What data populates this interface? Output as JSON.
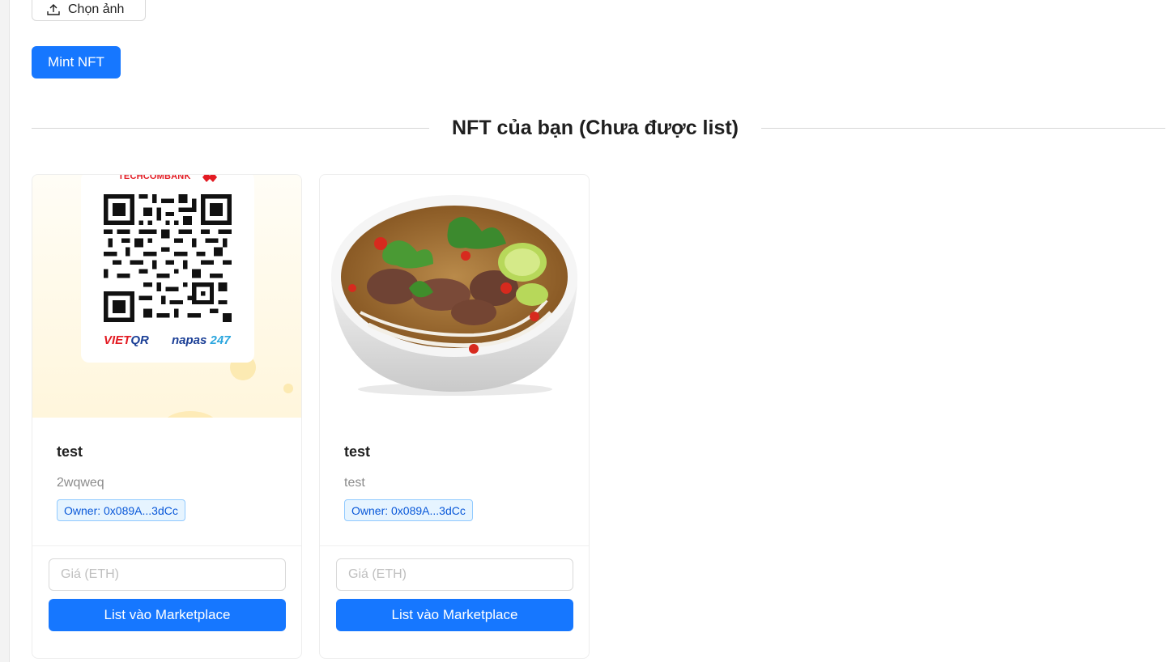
{
  "upload": {
    "label": "Chọn ảnh",
    "icon": "upload-icon"
  },
  "mint": {
    "label": "Mint NFT"
  },
  "section": {
    "title": "NFT của bạn (Chưa được list)"
  },
  "cards": [
    {
      "title": "test",
      "description": "2wqweq",
      "owner": "Owner: 0x089A...3dCc",
      "image": {
        "bank": "TECHCOMBANK",
        "viet": "VIET",
        "qr": "QR",
        "napas": "napas",
        "n247": "247"
      },
      "price_placeholder": "Giá (ETH)",
      "list_label": "List vào Marketplace"
    },
    {
      "title": "test",
      "description": "test",
      "owner": "Owner: 0x089A...3dCc",
      "price_placeholder": "Giá (ETH)",
      "list_label": "List vào Marketplace"
    }
  ],
  "colors": {
    "primary": "#1677ff",
    "tag_bg": "#e6f4ff",
    "tag_border": "#91caff",
    "tag_text": "#0958d9"
  }
}
